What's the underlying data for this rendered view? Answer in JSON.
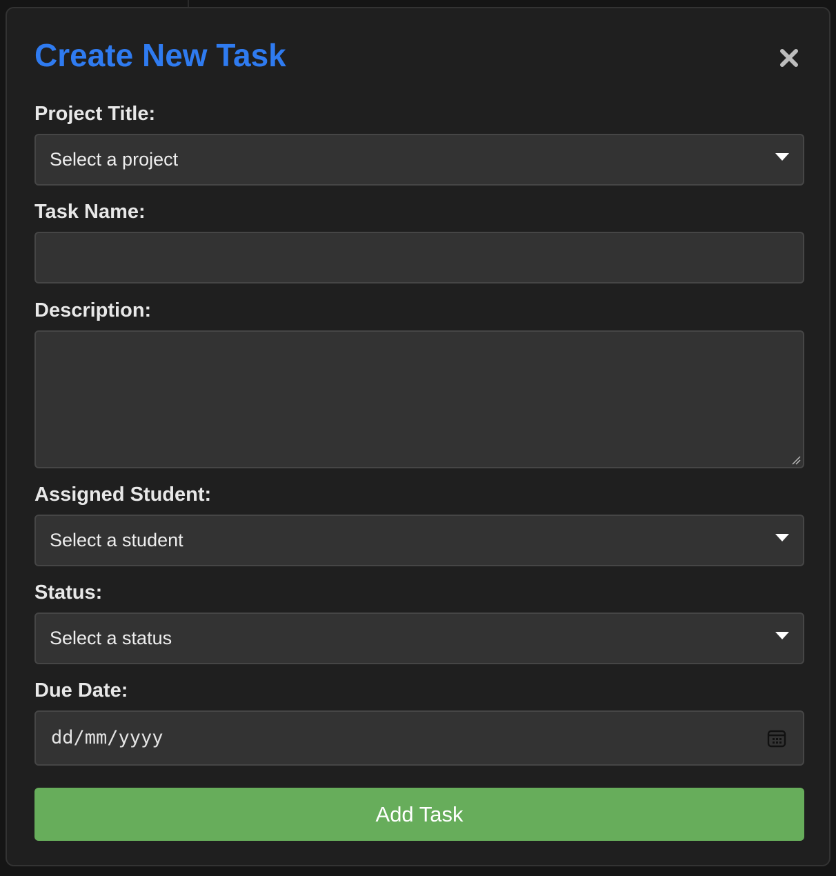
{
  "colors": {
    "accent": "#2f7bf0",
    "button": "#67ad5b",
    "background": "#1f1f1f",
    "field_background": "#333333"
  },
  "modal": {
    "title": "Create New Task",
    "close_icon": "close-icon"
  },
  "form": {
    "project": {
      "label": "Project Title:",
      "selected": "Select a project"
    },
    "task_name": {
      "label": "Task Name:",
      "value": ""
    },
    "description": {
      "label": "Description:",
      "value": ""
    },
    "student": {
      "label": "Assigned Student:",
      "selected": "Select a student"
    },
    "status": {
      "label": "Status:",
      "selected": "Select a status"
    },
    "due_date": {
      "label": "Due Date:",
      "placeholder": "dd/mm/yyyy",
      "icon": "calendar-icon"
    },
    "submit_label": "Add Task"
  }
}
